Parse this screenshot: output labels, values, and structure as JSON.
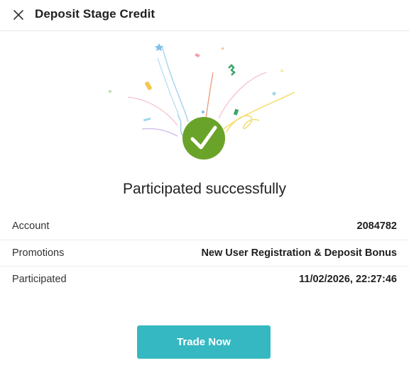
{
  "header": {
    "title": "Deposit Stage Credit",
    "close_icon": "close-icon"
  },
  "result": {
    "headline": "Participated successfully",
    "icon": "check-circle-icon",
    "accent_color": "#6aa329"
  },
  "details": [
    {
      "label": "Account",
      "value": "2084782"
    },
    {
      "label": "Promotions",
      "value": "New User Registration & Deposit Bonus"
    },
    {
      "label": "Participated",
      "value": "11/02/2026, 22:27:46"
    }
  ],
  "actions": {
    "trade_label": "Trade Now",
    "button_color": "#35b8c2"
  }
}
